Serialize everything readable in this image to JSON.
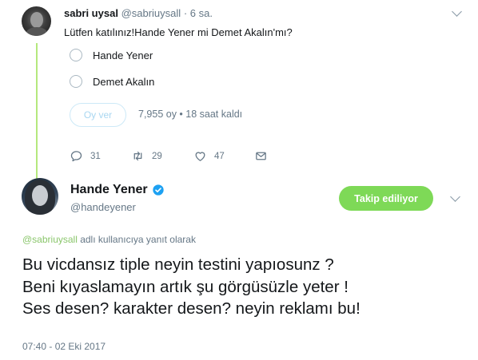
{
  "tweet": {
    "name": "sabri uysal",
    "handle": "@sabriuysall",
    "separator": "·",
    "time": "6 sa.",
    "text": "Lütfen katılınız!Hande Yener mi Demet Akalın'mı?",
    "poll": {
      "options": [
        "Hande Yener",
        "Demet Akalın"
      ],
      "vote_label": "Oy ver",
      "meta": "7,955 oy • 18 saat kaldı"
    },
    "actions": {
      "replies": "31",
      "retweets": "29",
      "likes": "47"
    }
  },
  "reply": {
    "name": "Hande Yener",
    "handle": "@handeyener",
    "follow_label": "Takip ediliyor",
    "context_mention": "@sabriuysall",
    "context_text": " adlı kullanıcıya yanıt olarak",
    "text_lines": [
      "Bu vicdansız tiple neyin testini yapıosunz ?",
      "Beni kıyaslamayın artık şu görgüsüzle yeter !",
      "Ses desen? karakter desen? neyin reklamı bu!"
    ],
    "timestamp": "07:40 - 02 Eki 2017"
  },
  "colors": {
    "accent_green": "#7ed957",
    "thread_line": "#b5e87d",
    "verified_blue": "#1da1f2",
    "muted_text": "#657786"
  },
  "icons": [
    "chevron-down-icon",
    "reply-icon",
    "retweet-icon",
    "like-icon",
    "direct-message-icon",
    "verified-badge-icon"
  ]
}
